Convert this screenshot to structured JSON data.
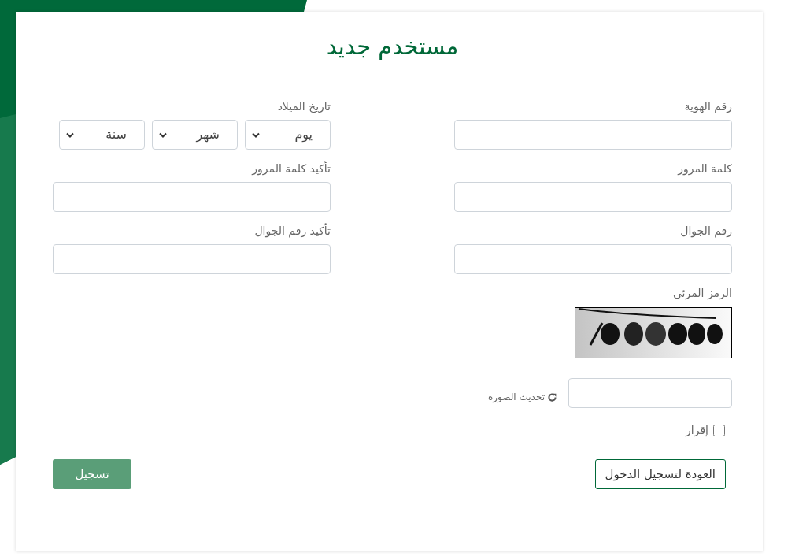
{
  "title": "مستخدم جديد",
  "fields": [
    {
      "kind": "text",
      "label": "رقم الهوية"
    },
    {
      "kind": "date",
      "label": "تاريخ الميلاد",
      "selects": [
        "يوم",
        "شهر",
        "سنة"
      ]
    },
    {
      "kind": "text",
      "label": "كلمة المرور"
    },
    {
      "kind": "text",
      "label": "تأكيد كلمة المرور"
    },
    {
      "kind": "text",
      "label": "رقم الجوال"
    },
    {
      "kind": "text",
      "label": "تأكيد رقم الجوال"
    }
  ],
  "captcha": {
    "label": "الرمز المرئي",
    "refresh_link": "تحديث الصورة"
  },
  "agreement": {
    "label": "إقرار",
    "checked": false
  },
  "buttons": [
    {
      "kind": "outline",
      "label": "العودة لتسجيل الدخول"
    },
    {
      "kind": "primary",
      "label": "تسجيل"
    }
  ]
}
